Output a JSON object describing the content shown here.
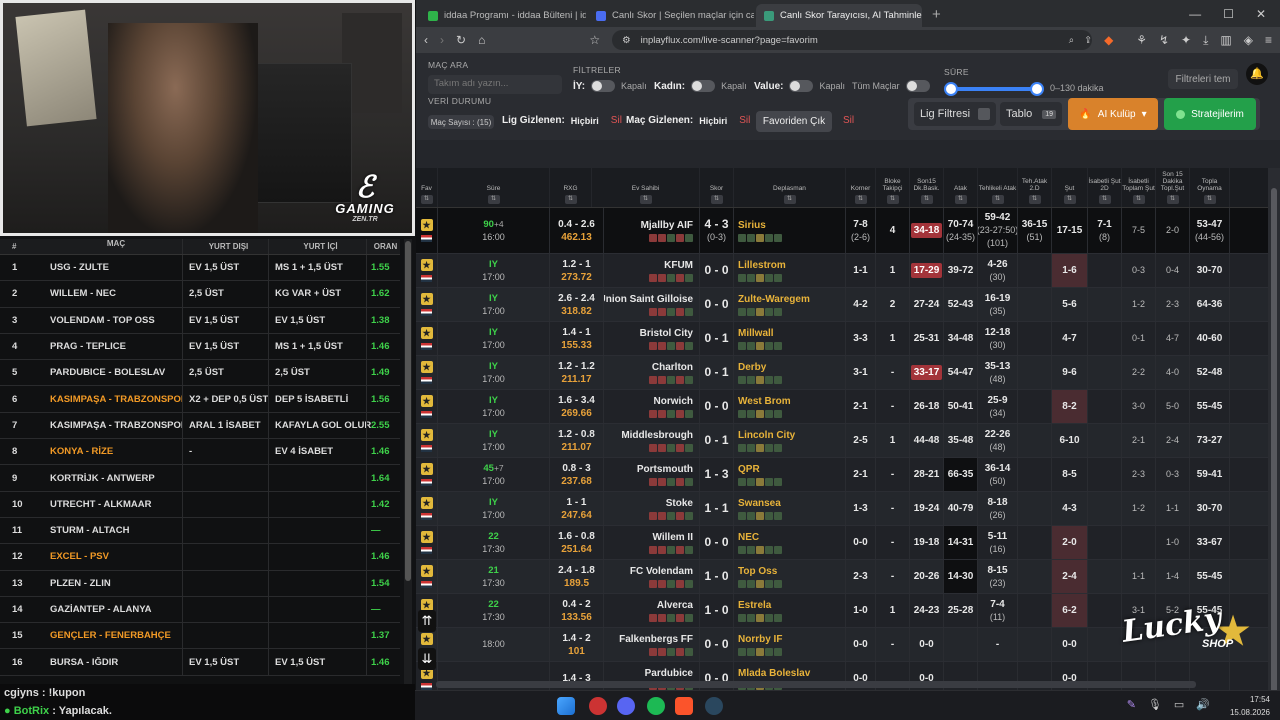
{
  "stream": {
    "logo_main": "GAMING",
    "logo_sub": "ZEN.TR",
    "table_headers": [
      "#",
      "MAÇ",
      "YURT DIŞI",
      "YURT İÇİ",
      "ORAN"
    ],
    "rows": [
      {
        "n": "1",
        "match": "USG - ZULTE",
        "abroad": "EV 1,5 ÜST",
        "home": "MS 1 + 1,5 ÜST",
        "odd": "1.55",
        "hl": false
      },
      {
        "n": "2",
        "match": "WILLEM - NEC",
        "abroad": "2,5 ÜST",
        "home": "KG VAR + ÜST",
        "odd": "1.62",
        "hl": false
      },
      {
        "n": "3",
        "match": "VOLENDAM - TOP OSS",
        "abroad": "EV 1,5 ÜST",
        "home": "EV 1,5 ÜST",
        "odd": "1.38",
        "hl": false
      },
      {
        "n": "4",
        "match": "PRAG - TEPLICE",
        "abroad": "EV 1,5 ÜST",
        "home": "MS 1 + 1,5 ÜST",
        "odd": "1.46",
        "hl": false
      },
      {
        "n": "5",
        "match": "PARDUBICE - BOLESLAV",
        "abroad": "2,5 ÜST",
        "home": "2,5 ÜST",
        "odd": "1.49",
        "hl": false
      },
      {
        "n": "6",
        "match": "KASIMPAŞA - TRABZONSPOR",
        "abroad": "X2 + DEP 0,5 ÜST",
        "home": "DEP 5 İSABETLİ",
        "odd": "1.56",
        "hl": true
      },
      {
        "n": "7",
        "match": "KASIMPAŞA - TRABZONSPOR",
        "abroad": "ARAL 1 İSABET",
        "home": "KAFAYLA GOL OLUR",
        "odd": "2.55",
        "hl": false
      },
      {
        "n": "8",
        "match": "KONYA - RİZE",
        "abroad": "-",
        "home": "EV 4 İSABET",
        "odd": "1.46",
        "hl": true
      },
      {
        "n": "9",
        "match": "KORTRİJK - ANTWERP",
        "abroad": "",
        "home": "",
        "odd": "1.64",
        "hl": false
      },
      {
        "n": "10",
        "match": "UTRECHT - ALKMAAR",
        "abroad": "",
        "home": "",
        "odd": "1.42",
        "hl": false
      },
      {
        "n": "11",
        "match": "STURM - ALTACH",
        "abroad": "",
        "home": "",
        "odd": "—",
        "hl": false
      },
      {
        "n": "12",
        "match": "EXCEL - PSV",
        "abroad": "",
        "home": "",
        "odd": "1.46",
        "hl": true
      },
      {
        "n": "13",
        "match": "PLZEN - ZLIN",
        "abroad": "",
        "home": "",
        "odd": "1.54",
        "hl": false
      },
      {
        "n": "14",
        "match": "GAZİANTEP - ALANYA",
        "abroad": "",
        "home": "",
        "odd": "—",
        "hl": false
      },
      {
        "n": "15",
        "match": "GENÇLER - FENERBAHÇE",
        "abroad": "",
        "home": "",
        "odd": "1.37",
        "hl": true
      },
      {
        "n": "16",
        "match": "BURSA - IĞDIR",
        "abroad": "EV 1,5 ÜST",
        "home": "EV 1,5 ÜST",
        "odd": "1.46",
        "hl": false
      }
    ],
    "chat": [
      {
        "user": "cgiyns",
        "msg": "!kupon"
      },
      {
        "user": "BotRix",
        "msg": "Yapılacak."
      }
    ]
  },
  "browser": {
    "tabs": [
      {
        "label": "iddaa Programı - iddaa Bülteni | iddaa",
        "color": "#2fb34a",
        "active": false
      },
      {
        "label": "Canlı Skor | Seçilen maçlar için canlı skor",
        "color": "#4a6cf0",
        "active": false
      },
      {
        "label": "Canlı Skor Tarayıcısı, AI Tahminleri",
        "color": "#3a9a7a",
        "active": true
      }
    ],
    "url": "inplayflux.com/live-scanner?page=favorim"
  },
  "filters": {
    "mac_ara": "MAÇ ARA",
    "search_placeholder": "Takım adı yazın...",
    "veri_durumu": "VERİ DURUMU",
    "filtreler": "FİLTRELER",
    "iy": "İY:",
    "kadin": "Kadın:",
    "value": "Value:",
    "kapali": "Kapalı",
    "tum_maclar": "Tüm Maçlar",
    "sure": "SÜRE",
    "sure_range": "0–130 dakika",
    "filtreleri_temizle": "Filtreleri tem",
    "mac_sayisi": "Maç Sayısı : (15)",
    "lig_gizlenen": "Lig Gizlenen:",
    "hicbiri": "Hiçbiri",
    "sil": "Sil",
    "mac_gizlenen": "Maç Gizlenen:",
    "favoriden_cik": "Favoriden Çık",
    "lig_filtresi": "Lig Filtresi",
    "tablo": "Tablo",
    "tablo_count": "19",
    "ai_kulup": "AI Kulüp",
    "stratejilerim": "Stratejilerim"
  },
  "grid_headers": [
    "Fav",
    "Süre",
    "RXG",
    "Ev Sahibi",
    "Skor",
    "Deplasman",
    "Korner",
    "Bloke Takipçi",
    "Son15 Dk.Bask.",
    "Atak",
    "Tehlikeli Atak",
    "Teh.Atak 2.D",
    "Şut",
    "İsabetli Şut 2D",
    "İsabetli Toplam Şut",
    "Son 15 Dakika Topl.Şut",
    "Topla Oynama"
  ],
  "grid_rows": [
    {
      "min": "90",
      "min2": "+4",
      "time": "16:00",
      "xg": "0.4 - 2.6",
      "pr": "462.13",
      "home": "Mjallby AIF",
      "score": "4 - 3",
      "hts": "(0-3)",
      "away": "Sirius",
      "corner": "7-8",
      "corner2": "(2-6)",
      "blok": "4",
      "son15": "34-18",
      "atak": "70-74",
      "atak2": "(24-35)",
      "teh": "59-42",
      "teh2": "(23-27:50)",
      "teh3": "(101)",
      "teh2d": "36-15",
      "teh2d2": "(51)",
      "sut": "17-15",
      "isab2d": "7-1",
      "isab2d2": "(8)",
      "isab": "7-5",
      "son15s": "2-0",
      "topla": "53-47",
      "topla2": "(44-56)"
    },
    {
      "min": "IY",
      "time": "17:00",
      "xg": "1.2 - 1",
      "pr": "273.72",
      "home": "KFUM",
      "score": "0 - 0",
      "away": "Lillestrom",
      "corner": "1-1",
      "blok": "1",
      "son15": "17-29",
      "atak": "39-72",
      "teh": "4-26",
      "teh2": "(30)",
      "sut": "1-6",
      "isab": "0-3",
      "son15s": "0-4",
      "topla": "30-70"
    },
    {
      "min": "IY",
      "time": "17:00",
      "xg": "2.6 - 2.4",
      "pr": "318.82",
      "home": "Union Saint Gilloise",
      "score": "0 - 0",
      "away": "Zulte-Waregem",
      "corner": "4-2",
      "blok": "2",
      "son15": "27-24",
      "atak": "52-43",
      "teh": "16-19",
      "teh2": "(35)",
      "sut": "5-6",
      "isab": "1-2",
      "son15s": "2-3",
      "topla": "64-36"
    },
    {
      "min": "IY",
      "time": "17:00",
      "xg": "1.4 - 1",
      "pr": "155.33",
      "home": "Bristol City",
      "score": "0 - 1",
      "away": "Millwall",
      "corner": "3-3",
      "blok": "1",
      "son15": "25-31",
      "atak": "34-48",
      "teh": "12-18",
      "teh2": "(30)",
      "sut": "4-7",
      "isab": "0-1",
      "son15s": "4-7",
      "topla": "40-60"
    },
    {
      "min": "IY",
      "time": "17:00",
      "xg": "1.2 - 1.2",
      "pr": "211.17",
      "home": "Charlton",
      "score": "0 - 1",
      "away": "Derby",
      "corner": "3-1",
      "blok": "-",
      "son15": "33-17",
      "atak": "54-47",
      "teh": "35-13",
      "teh2": "(48)",
      "sut": "9-6",
      "isab": "2-2",
      "son15s": "4-0",
      "topla": "52-48"
    },
    {
      "min": "IY",
      "time": "17:00",
      "xg": "1.6 - 3.4",
      "pr": "269.66",
      "home": "Norwich",
      "score": "0 - 0",
      "away": "West Brom",
      "corner": "2-1",
      "blok": "-",
      "son15": "26-18",
      "atak": "50-41",
      "teh": "25-9",
      "teh2": "(34)",
      "sut": "8-2",
      "isab": "3-0",
      "son15s": "5-0",
      "topla": "55-45"
    },
    {
      "min": "IY",
      "time": "17:00",
      "xg": "1.2 - 0.8",
      "pr": "211.07",
      "home": "Middlesbrough",
      "score": "0 - 1",
      "away": "Lincoln City",
      "corner": "2-5",
      "blok": "1",
      "son15": "44-48",
      "atak": "35-48",
      "teh": "22-26",
      "teh2": "(48)",
      "sut": "6-10",
      "isab": "2-1",
      "son15s": "2-4",
      "topla": "73-27"
    },
    {
      "min": "45",
      "min2": "+7",
      "time": "17:00",
      "xg": "0.8 - 3",
      "pr": "237.68",
      "home": "Portsmouth",
      "score": "1 - 3",
      "away": "QPR",
      "corner": "2-1",
      "blok": "-",
      "son15": "28-21",
      "atak": "66-35",
      "teh": "36-14",
      "teh2": "(50)",
      "sut": "8-5",
      "isab": "2-3",
      "son15s": "0-3",
      "topla": "59-41"
    },
    {
      "min": "IY",
      "time": "17:00",
      "xg": "1 - 1",
      "pr": "247.64",
      "home": "Stoke",
      "score": "1 - 1",
      "away": "Swansea",
      "corner": "1-3",
      "blok": "-",
      "son15": "19-24",
      "atak": "40-79",
      "teh": "8-18",
      "teh2": "(26)",
      "sut": "4-3",
      "isab": "1-2",
      "son15s": "1-1",
      "topla": "30-70"
    },
    {
      "min": "22",
      "time": "17:30",
      "xg": "1.6 - 0.8",
      "pr": "251.64",
      "home": "Willem II",
      "score": "0 - 0",
      "away": "NEC",
      "corner": "0-0",
      "blok": "-",
      "son15": "19-18",
      "atak": "14-31",
      "teh": "5-11",
      "teh2": "(16)",
      "sut": "2-0",
      "isab": "",
      "son15s": "1-0",
      "topla": "33-67"
    },
    {
      "min": "21",
      "time": "17:30",
      "xg": "2.4 - 1.8",
      "pr": "189.5",
      "home": "FC Volendam",
      "score": "1 - 0",
      "away": "Top Oss",
      "corner": "2-3",
      "blok": "-",
      "son15": "20-26",
      "atak": "14-30",
      "teh": "8-15",
      "teh2": "(23)",
      "sut": "2-4",
      "isab": "1-1",
      "son15s": "1-4",
      "topla": "55-45"
    },
    {
      "min": "22",
      "time": "17:30",
      "xg": "0.4 - 2",
      "pr": "133.56",
      "home": "Alverca",
      "score": "1 - 0",
      "away": "Estrela",
      "corner": "1-0",
      "blok": "1",
      "son15": "24-23",
      "atak": "25-28",
      "teh": "7-4",
      "teh2": "(11)",
      "sut": "6-2",
      "isab": "3-1",
      "son15s": "5-2",
      "topla": "55-45"
    },
    {
      "min": "",
      "time": "18:00",
      "xg": "1.4 - 2",
      "pr": "101",
      "home": "Falkenbergs FF",
      "score": "0 - 0",
      "away": "Norrby IF",
      "corner": "0-0",
      "blok": "-",
      "son15": "0-0",
      "atak": "",
      "teh": "-",
      "teh2": "",
      "sut": "0-0",
      "isab": "",
      "son15s": "",
      "topla": ""
    },
    {
      "min": "",
      "time": "",
      "xg": "1.4 - 3",
      "pr": "",
      "home": "Pardubice",
      "score": "0 - 0",
      "away": "Mlada Boleslav",
      "corner": "0-0",
      "blok": "",
      "son15": "0-0",
      "atak": "",
      "teh": "",
      "teh2": "",
      "sut": "0-0",
      "isab": "",
      "son15s": "",
      "topla": ""
    }
  ],
  "brand": {
    "lucky": "Lucky",
    "shop": "SHOP"
  },
  "taskbar": {
    "time": "17:54",
    "date": "15.08.2026"
  }
}
